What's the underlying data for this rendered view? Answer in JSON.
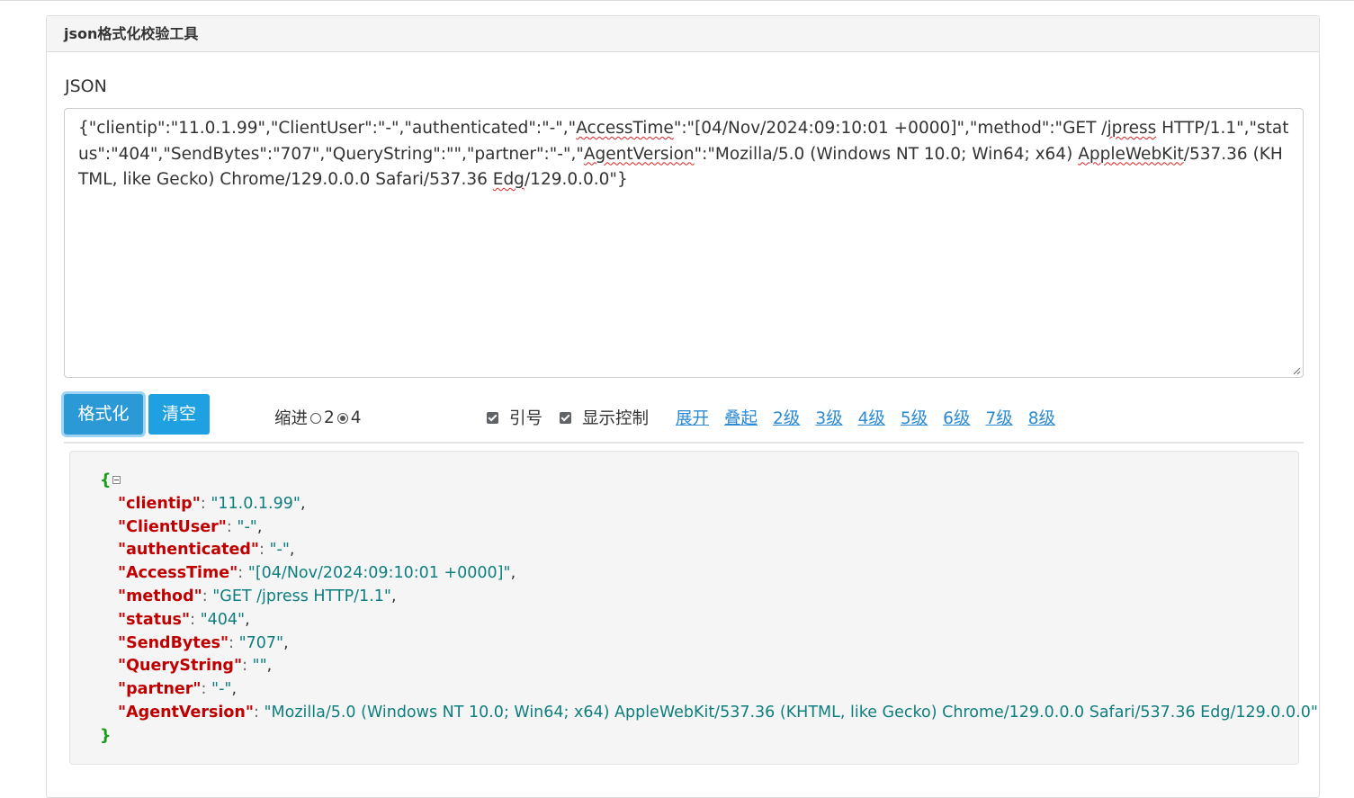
{
  "panel": {
    "title": "json格式化校验工具"
  },
  "input": {
    "label": "JSON",
    "segments": [
      {
        "t": "{\"clientip\":\"11.0.1.99\",\"ClientUser\":\"-\",\"authenticated\":\"-\",\""
      },
      {
        "t": "AccessTime",
        "sq": true
      },
      {
        "t": "\":\"[04/Nov/2024:09:10:01 +0000]\",\"method\":\"GET /"
      },
      {
        "t": "jpress",
        "sq": true
      },
      {
        "t": " HTTP/1.1\",\"status\":\"404\",\"SendBytes\":\"707\",\"QueryString\":\"\",\"partner\":\"-\",\""
      },
      {
        "t": "AgentVersion",
        "sq": true
      },
      {
        "t": "\":\"Mozilla/5.0 (Windows NT 10.0; Win64; x64) "
      },
      {
        "t": "AppleWebKit",
        "sq": true
      },
      {
        "t": "/537.36 (KHTML, like Gecko) Chrome/129.0.0.0 Safari/537.36 "
      },
      {
        "t": "Edg",
        "sq": true
      },
      {
        "t": "/129.0.0.0\"}"
      }
    ]
  },
  "toolbar": {
    "format_label": "格式化",
    "clear_label": "清空",
    "indent_label": "缩进",
    "indent_options": [
      "2",
      "4"
    ],
    "indent_selected": "4",
    "quote_label": "引号",
    "quote_checked": true,
    "control_label": "显示控制",
    "control_checked": true,
    "links": [
      "展开",
      "叠起",
      "2级",
      "3级",
      "4级",
      "5级",
      "6级",
      "7级",
      "8级"
    ]
  },
  "output": {
    "open_brace": "{",
    "close_brace": "}",
    "entries": [
      {
        "key": "clientip",
        "value": "11.0.1.99"
      },
      {
        "key": "ClientUser",
        "value": "-"
      },
      {
        "key": "authenticated",
        "value": "-"
      },
      {
        "key": "AccessTime",
        "value": "[04/Nov/2024:09:10:01 +0000]"
      },
      {
        "key": "method",
        "value": "GET /jpress HTTP/1.1"
      },
      {
        "key": "status",
        "value": "404"
      },
      {
        "key": "SendBytes",
        "value": "707"
      },
      {
        "key": "QueryString",
        "value": ""
      },
      {
        "key": "partner",
        "value": "-"
      },
      {
        "key": "AgentVersion",
        "value": "Mozilla/5.0 (Windows NT 10.0; Win64; x64) AppleWebKit/537.36 (KHTML, like Gecko) Chrome/129.0.0.0 Safari/537.36 Edg/129.0.0.0"
      }
    ]
  },
  "colors": {
    "button": "#1fa0e0",
    "link": "#2a8ad4",
    "json_key": "#c00000",
    "json_value": "#0e7e7e",
    "json_brace": "#1a9e1a"
  }
}
